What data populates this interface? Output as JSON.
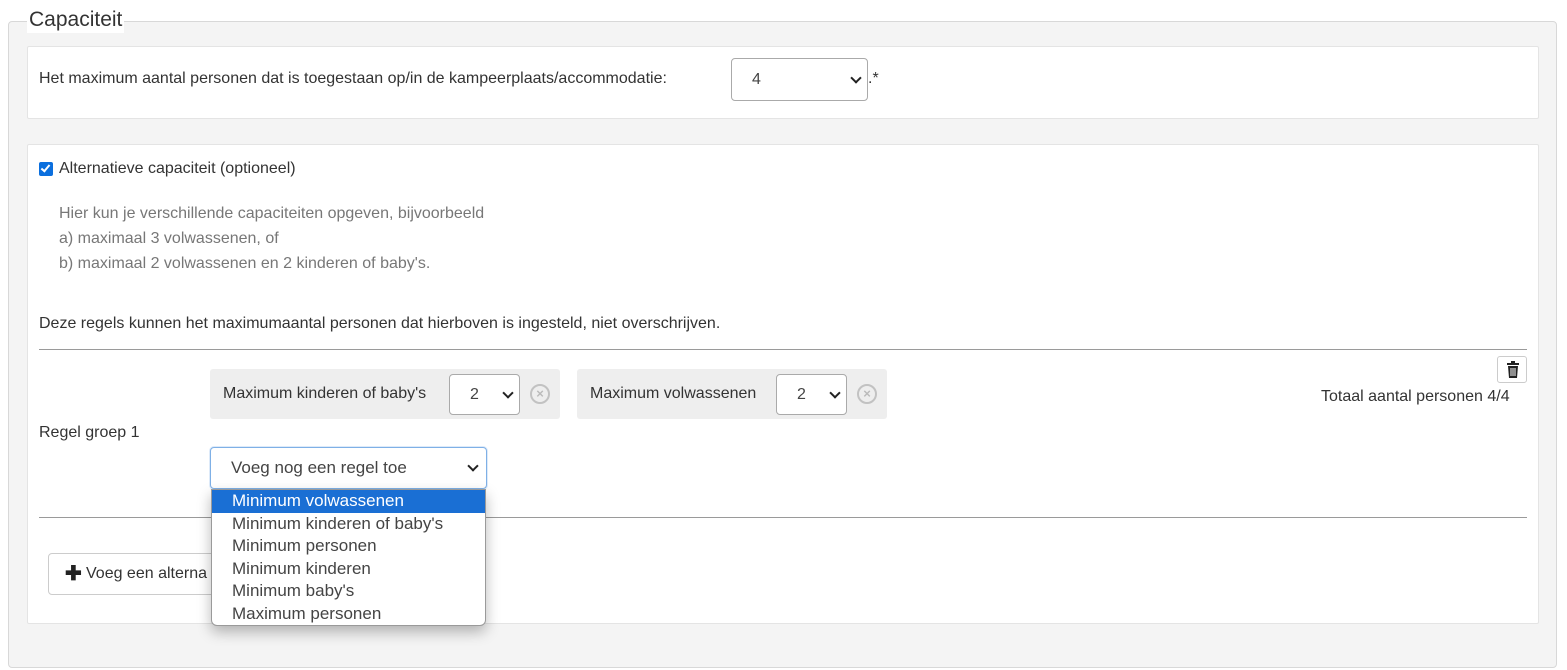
{
  "section": {
    "legend": "Capaciteit"
  },
  "max_capacity": {
    "label": "Het maximum aantal personen dat is toegestaan op/in de kampeerplaats/accommodatie:",
    "value": "4",
    "required_mark": ".*"
  },
  "alt_capacity": {
    "checkbox_label": "Alternatieve capaciteit (optioneel)",
    "checked": true,
    "help_lines": [
      "Hier kun je verschillende capaciteiten opgeven, bijvoorbeeld",
      "a) maximaal 3 volwassenen, of",
      "b) maximaal 2 volwassenen en 2 kinderen of baby's."
    ],
    "note": "Deze regels kunnen het maximumaantal personen dat hierboven is ingesteld, niet overschrijven."
  },
  "rule_group": {
    "label": "Regel groep 1",
    "rules": [
      {
        "label": "Maximum kinderen of baby's",
        "value": "2"
      },
      {
        "label": "Maximum volwassenen",
        "value": "2"
      }
    ],
    "total_label": "Totaal aantal personen 4/4",
    "add_rule_select": {
      "value": "Voeg nog een regel toe",
      "options": [
        "Minimum volwassenen",
        "Minimum kinderen of baby's",
        "Minimum personen",
        "Minimum kinderen",
        "Minimum baby's",
        "Maximum personen"
      ],
      "highlighted_option": "Minimum volwassenen"
    }
  },
  "add_alt_button": {
    "label": "Voeg een alterna"
  },
  "colors": {
    "accent": "#1a6fd4",
    "checkbox": "#0b6fde"
  },
  "icons": {
    "trash": "trash-icon",
    "clear": "clear-circle-icon",
    "plus": "plus-icon"
  }
}
